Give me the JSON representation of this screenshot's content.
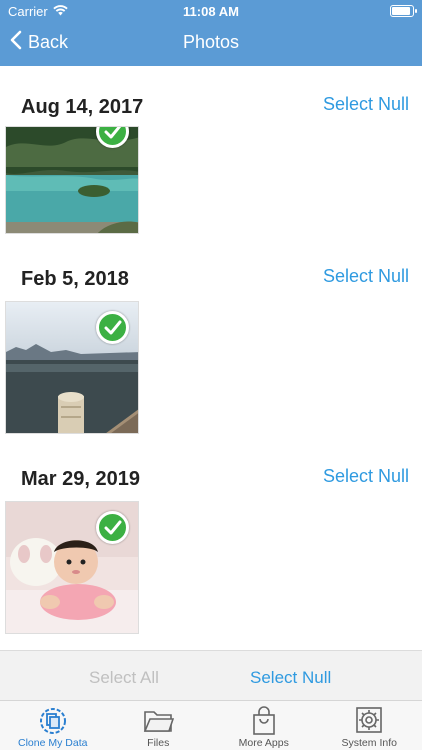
{
  "status": {
    "carrier": "Carrier",
    "time": "11:08 AM"
  },
  "nav": {
    "back_label": "Back",
    "title": "Photos"
  },
  "sections": [
    {
      "date": "Aug 14, 2017",
      "select_label": "Select Null"
    },
    {
      "date": "Feb 5, 2018",
      "select_label": "Select Null"
    },
    {
      "date": "Mar 29, 2019",
      "select_label": "Select Null"
    }
  ],
  "actions": {
    "select_all": "Select All",
    "select_null": "Select Null"
  },
  "tabs": [
    {
      "label": "Clone My Data",
      "icon": "clone-icon",
      "active": true
    },
    {
      "label": "Files",
      "icon": "folder-icon",
      "active": false
    },
    {
      "label": "More Apps",
      "icon": "shopping-bag-icon",
      "active": false
    },
    {
      "label": "System Info",
      "icon": "gear-icon",
      "active": false
    }
  ],
  "colors": {
    "header": "#5b9bd5",
    "accent": "#2f9ae0",
    "check": "#3cb043"
  }
}
